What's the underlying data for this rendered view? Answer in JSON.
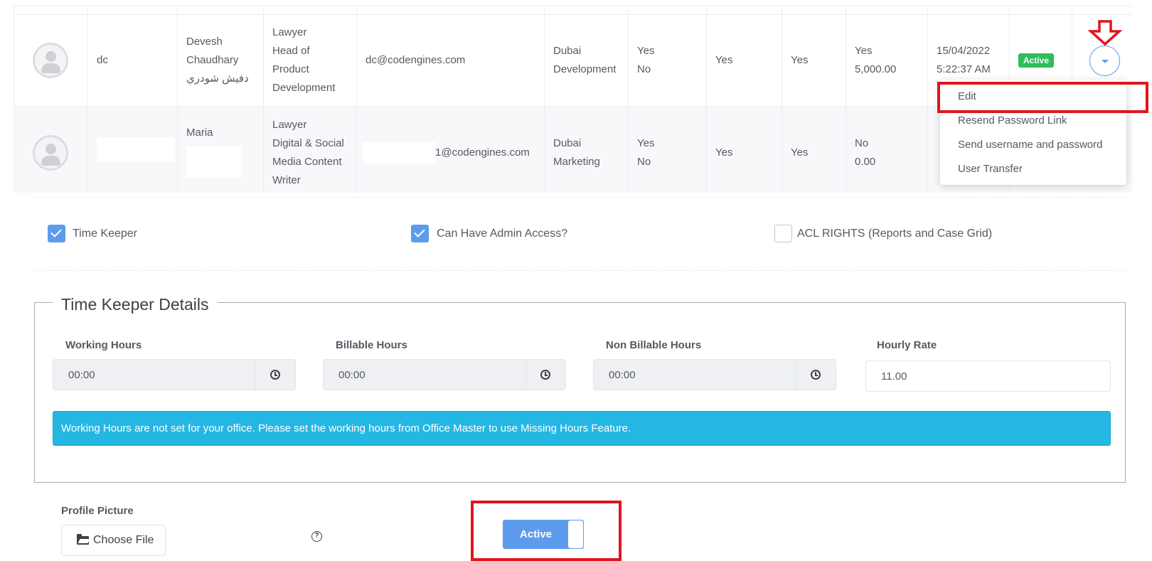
{
  "table": {
    "rows": [
      {
        "username": "dc",
        "name_line1": "Devesh",
        "name_line2": "Chaudhary",
        "name_arabic": "دفيش شودري",
        "role_lines": [
          "Lawyer",
          "Head of",
          "Product",
          "Development"
        ],
        "email": "dc@codengines.com",
        "dept_line1": "Dubai",
        "dept_line2": "Development",
        "flag1_line1": "Yes",
        "flag1_line2": "No",
        "flag2": "Yes",
        "flag3": "Yes",
        "rate_line1": "Yes",
        "rate_line2": "5,000.00",
        "date_line1": "15/04/2022",
        "date_line2": "5:22:37 AM",
        "status": "Active"
      },
      {
        "username": "",
        "name_line1": "Maria",
        "role_lines": [
          "Lawyer",
          "Digital & Social",
          "Media Content",
          "Writer"
        ],
        "email": "1@codengines.com",
        "dept_line1": "Dubai",
        "dept_line2": "Marketing",
        "flag1_line1": "Yes",
        "flag1_line2": "No",
        "flag2": "Yes",
        "flag3": "Yes",
        "rate_line1": "No",
        "rate_line2": "0.00"
      }
    ]
  },
  "dropdown": {
    "items": [
      "Edit",
      "Resend Password Link",
      "Send username and password",
      "User Transfer"
    ]
  },
  "options": {
    "time_keeper": {
      "label": "Time Keeper",
      "checked": true
    },
    "admin_access": {
      "label": "Can Have Admin Access?",
      "checked": true
    },
    "acl_rights": {
      "label": "ACL RIGHTS (Reports and Case Grid)",
      "checked": false
    }
  },
  "time_keeper_details": {
    "legend": "Time Keeper Details",
    "working_hours": {
      "label": "Working Hours",
      "value": "00:00"
    },
    "billable_hours": {
      "label": "Billable Hours",
      "value": "00:00"
    },
    "non_billable_hours": {
      "label": "Non Billable Hours",
      "value": "00:00"
    },
    "hourly_rate": {
      "label": "Hourly Rate",
      "value": "11.00"
    },
    "alert": "Working Hours are not set for your office. Please set the working hours from Office Master to use Missing Hours Feature."
  },
  "profile": {
    "label": "Profile Picture",
    "choose_file": "Choose File",
    "help_glyph": "?"
  },
  "status_toggle": {
    "label": "Active"
  },
  "colors": {
    "primary": "#5d9cec",
    "alert_bg": "#25b7e4",
    "badge_green": "#2fbd5a",
    "annotation_red": "#e0141e"
  }
}
